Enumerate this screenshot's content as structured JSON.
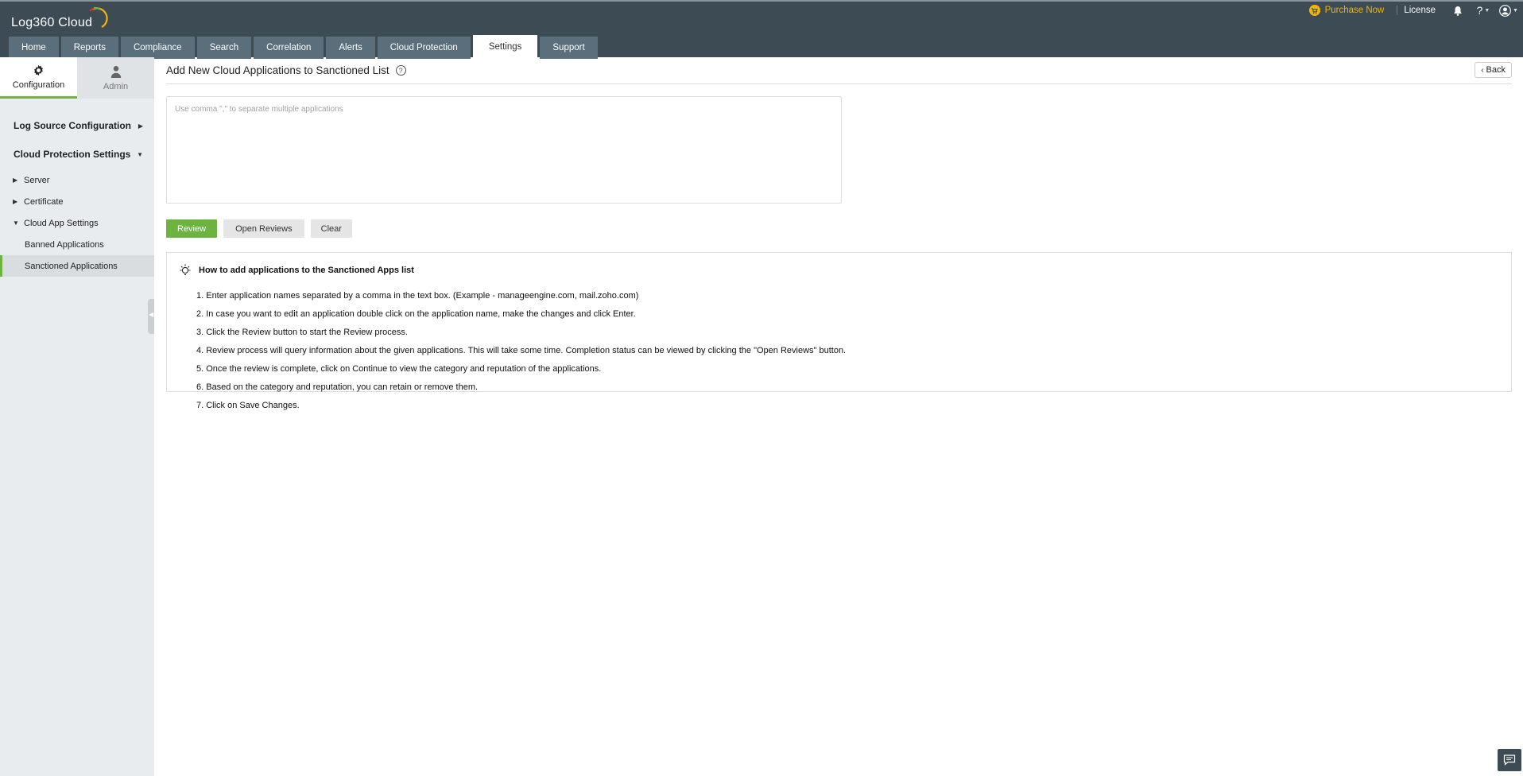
{
  "app": {
    "logo_text": "Log360  Cloud"
  },
  "topbar": {
    "purchase_label": "Purchase Now",
    "license_label": "License",
    "bell_icon": "bell-icon",
    "help_label": "?",
    "user_icon": "user-circle-icon"
  },
  "nav": {
    "tabs": [
      {
        "label": "Home"
      },
      {
        "label": "Reports"
      },
      {
        "label": "Compliance"
      },
      {
        "label": "Search"
      },
      {
        "label": "Correlation"
      },
      {
        "label": "Alerts"
      },
      {
        "label": "Cloud Protection"
      },
      {
        "label": "Settings"
      },
      {
        "label": "Support"
      }
    ],
    "active": "Settings"
  },
  "sidebar": {
    "tabs": [
      {
        "label": "Configuration",
        "icon": "gear-icon"
      },
      {
        "label": "Admin",
        "icon": "person-icon"
      }
    ],
    "sections": [
      {
        "label": "Log Source Configuration"
      },
      {
        "label": "Cloud Protection Settings"
      }
    ],
    "items": [
      {
        "label": "Server"
      },
      {
        "label": "Certificate"
      },
      {
        "label": "Cloud App Settings"
      }
    ],
    "subitems": [
      {
        "label": "Banned Applications"
      },
      {
        "label": "Sanctioned Applications"
      }
    ]
  },
  "main": {
    "title": "Add New Cloud Applications to Sanctioned List",
    "back_label": "Back",
    "input_placeholder": "Use comma \",\" to separate multiple applications",
    "buttons": {
      "review": "Review",
      "open_reviews": "Open Reviews",
      "clear": "Clear"
    },
    "info": {
      "heading": "How to add applications to the Sanctioned Apps list",
      "steps": [
        "1. Enter application names separated by a comma in the text box. (Example - manageengine.com, mail.zoho.com)",
        "2. In case you want to edit an application double click on the application name, make the changes and click Enter.",
        "3. Click the Review button to start the Review process.",
        "4. Review process will query information about the given applications. This will take some time. Completion status can be viewed by clicking the \"Open Reviews\" button.",
        "5. Once the review is complete, click on Continue to view the category and reputation of the applications.",
        "6. Based on the category and reputation, you can retain or remove them.",
        "7. Click on Save Changes."
      ]
    }
  },
  "colors": {
    "header_bg": "#3d4b55",
    "accent_green": "#6cb33f",
    "purchase_gold": "#f4b400"
  }
}
